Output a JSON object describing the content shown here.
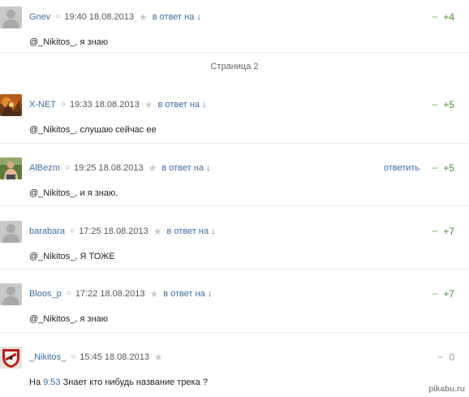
{
  "page_separator": "Страница 2",
  "watermark": "pikabu.ru",
  "comments": [
    {
      "username": "Gnev",
      "timestamp": "19:40 18.08.2013",
      "reply_to": "в ответ на ↓",
      "reply_label": "",
      "minus": "−",
      "rating": "+4",
      "text": "@_Nikitos_, я знаю",
      "avatar": "default-avatar"
    },
    {
      "username": "X-NET",
      "timestamp": "19:33 18.08.2013",
      "reply_to": "в ответ на ↓",
      "reply_label": "",
      "minus": "−",
      "rating": "+5",
      "text": "@_Nikitos_, слушаю сейчас ее",
      "avatar": "image-avatar-orange"
    },
    {
      "username": "AlBezm",
      "timestamp": "19:25 18.08.2013",
      "reply_to": "в ответ на ↓",
      "reply_label": "ответить",
      "minus": "−",
      "rating": "+5",
      "text": "@_Nikitos_, и я знаю.",
      "avatar": "image-avatar-photo"
    },
    {
      "username": "barabara",
      "timestamp": "17:25 18.08.2013",
      "reply_to": "в ответ на ↓",
      "reply_label": "",
      "minus": "−",
      "rating": "+7",
      "text": "@_Nikitos_, Я ТОЖЕ",
      "avatar": "default-avatar"
    },
    {
      "username": "Bloos_p",
      "timestamp": "17:22 18.08.2013",
      "reply_to": "в ответ на ↓",
      "reply_label": "",
      "minus": "−",
      "rating": "+7",
      "text": "@_Nikitos_, я знаю",
      "avatar": "default-avatar"
    },
    {
      "username": "_Nikitos_",
      "timestamp": "15:45 18.08.2013",
      "reply_to": "",
      "reply_label": "",
      "minus": "−",
      "rating": "0",
      "text_prefix": "На",
      "text_time_link": "9:53",
      "text_suffix": "Знает кто нибудь название трека ?",
      "avatar": "image-avatar-red"
    }
  ]
}
